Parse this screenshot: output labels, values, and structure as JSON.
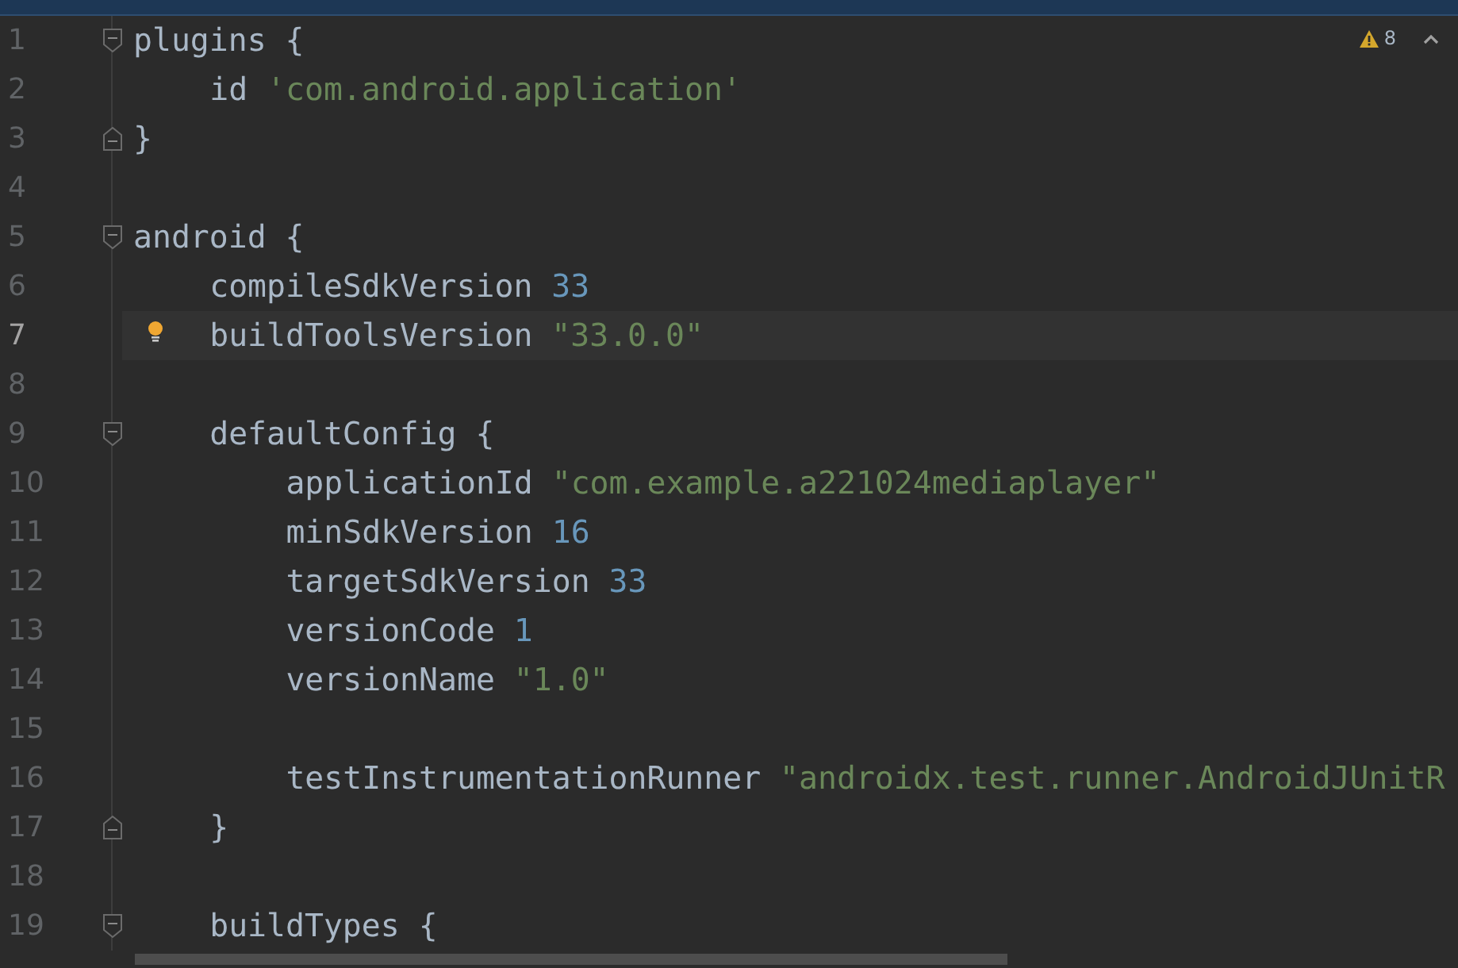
{
  "inspections": {
    "count": "8"
  },
  "lines": [
    {
      "number": "1",
      "kind": "fold-start",
      "selected": false,
      "tokens": [
        {
          "kind": "plain",
          "text": "plugins {"
        }
      ],
      "children": [
        {
          "number": "2",
          "kind": "plain",
          "selected": false,
          "tokens": [
            {
              "kind": "plain",
              "text": "id "
            },
            {
              "kind": "string",
              "text": "'com.android.application'"
            }
          ]
        }
      ]
    },
    {
      "number": "3",
      "kind": "fold-end",
      "selected": false,
      "tokens": [
        {
          "kind": "plain",
          "text": "}"
        }
      ]
    },
    {
      "number": "4",
      "kind": "plain",
      "selected": false
    },
    {
      "number": "5",
      "kind": "fold-start",
      "selected": false,
      "tokens": [
        {
          "kind": "plain",
          "text": "android {"
        }
      ],
      "children": [
        {
          "number": "6",
          "kind": "plain",
          "selected": false,
          "tokens": [
            {
              "kind": "plain",
              "text": "compileSdkVersion "
            },
            {
              "kind": "number",
              "text": "33"
            }
          ]
        },
        {
          "number": "7",
          "kind": "plain",
          "selected": true,
          "intention": true,
          "tokens": [
            {
              "kind": "plain",
              "text": "buildToolsVersion "
            },
            {
              "kind": "string",
              "text": "\"33.0.0\""
            }
          ]
        },
        {
          "number": "8",
          "kind": "plain",
          "selected": false
        },
        {
          "number": "9",
          "kind": "fold-start",
          "selected": false,
          "tokens": [
            {
              "kind": "plain",
              "text": "defaultConfig {"
            }
          ],
          "children": [
            {
              "number": "10",
              "kind": "plain",
              "selected": false,
              "tokens": [
                {
                  "kind": "plain",
                  "text": "applicationId "
                },
                {
                  "kind": "string",
                  "text": "\"com.example.a221024mediaplayer\""
                }
              ]
            },
            {
              "number": "11",
              "kind": "plain",
              "selected": false,
              "tokens": [
                {
                  "kind": "plain",
                  "text": "minSdkVersion "
                },
                {
                  "kind": "number",
                  "text": "16"
                }
              ]
            },
            {
              "number": "12",
              "kind": "plain",
              "selected": false,
              "tokens": [
                {
                  "kind": "plain",
                  "text": "targetSdkVersion "
                },
                {
                  "kind": "number",
                  "text": "33"
                }
              ]
            },
            {
              "number": "13",
              "kind": "plain",
              "selected": false,
              "tokens": [
                {
                  "kind": "plain",
                  "text": "versionCode "
                },
                {
                  "kind": "number",
                  "text": "1"
                }
              ]
            },
            {
              "number": "14",
              "kind": "plain",
              "selected": false,
              "tokens": [
                {
                  "kind": "plain",
                  "text": "versionName "
                },
                {
                  "kind": "string",
                  "text": "\"1.0\""
                }
              ]
            },
            {
              "number": "15",
              "kind": "plain",
              "selected": false
            },
            {
              "number": "16",
              "kind": "plain",
              "selected": false,
              "tokens": [
                {
                  "kind": "plain",
                  "text": "testInstrumentationRunner "
                },
                {
                  "kind": "string",
                  "text": "\"androidx.test.runner.AndroidJUnitR"
                }
              ]
            }
          ]
        },
        {
          "number": "17",
          "kind": "fold-end",
          "selected": false,
          "tokens": [
            {
              "kind": "plain",
              "text": "}"
            }
          ]
        },
        {
          "number": "18",
          "kind": "plain",
          "selected": false
        },
        {
          "number": "19",
          "kind": "fold-start",
          "selected": false,
          "tokens": [
            {
              "kind": "plain",
              "text": "buildTypes {"
            }
          ]
        }
      ]
    }
  ]
}
